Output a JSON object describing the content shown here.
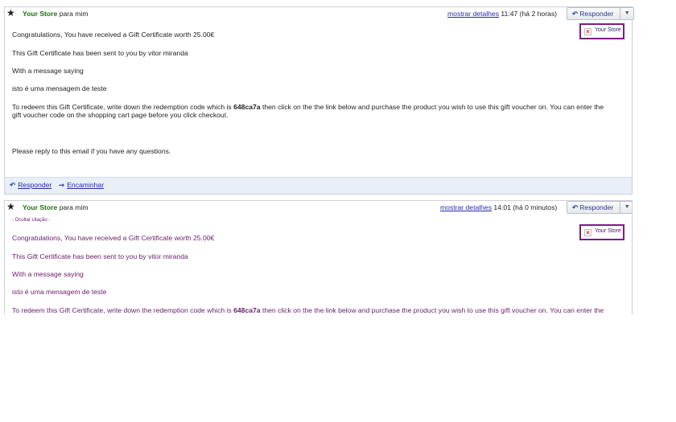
{
  "messages": [
    {
      "sender": "Your Store",
      "recipient": "para mim",
      "details_link": "mostrar detalhes",
      "time": "11:47 (há 2 horas)",
      "reply_label": "Responder",
      "more_label": "▼",
      "card_name": "Your Store",
      "body": {
        "line1": "Congratulations, You have received a Gift Certificate worth 25.00€",
        "line2": "This Gift Certificate has been sent to you by vitor miranda",
        "line3": "With a message saying",
        "line4": "isto é uma mensagem de teste",
        "redeem_pre": "To redeem this Gift Certificate, write down the redemption code which is ",
        "code": "648ca7a",
        "redeem_post": " then click on the the link below and purchase the product you wish to use this gift voucher on. You can enter the gift voucher code on the shopping cart page before you click checkout.",
        "closing": "Please reply to this email if you have any questions."
      },
      "footer": {
        "reply": "Responder",
        "forward": "Encaminhar"
      }
    },
    {
      "sender": "Your Store",
      "recipient": "para mim",
      "details_link": "mostrar detalhes",
      "time": "14:01 (há 0 minutos)",
      "reply_label": "Responder",
      "more_label": "▼",
      "card_name": "Your Store",
      "hide_quote": "- Ocultar citação -",
      "body": {
        "line1": "Congratulations, You have received a Gift Certificate worth 25.00€",
        "line2": "This Gift Certificate has been sent to you by vitor miranda",
        "line3": "With a message saying",
        "line4": "isto é uma mensagem de teste",
        "redeem_pre": "To redeem this Gift Certificate, write down the redemption code which is ",
        "code": "648ca7a",
        "redeem_post": " then click on the the link below and purchase the product you wish to use this gift voucher on. You can enter the gift"
      }
    }
  ],
  "colors": {
    "sender": "#1f6f14",
    "link": "#2a2ab0",
    "quoted_text": "#6a1b6a",
    "card_border": "#7a1f7a",
    "footer_bg": "#e8eff6"
  },
  "icons": {
    "star": "star-icon",
    "reply": "reply-arrow-icon",
    "forward": "forward-arrow-icon",
    "dropdown": "chevron-down-icon",
    "broken_image": "broken-image-icon"
  }
}
